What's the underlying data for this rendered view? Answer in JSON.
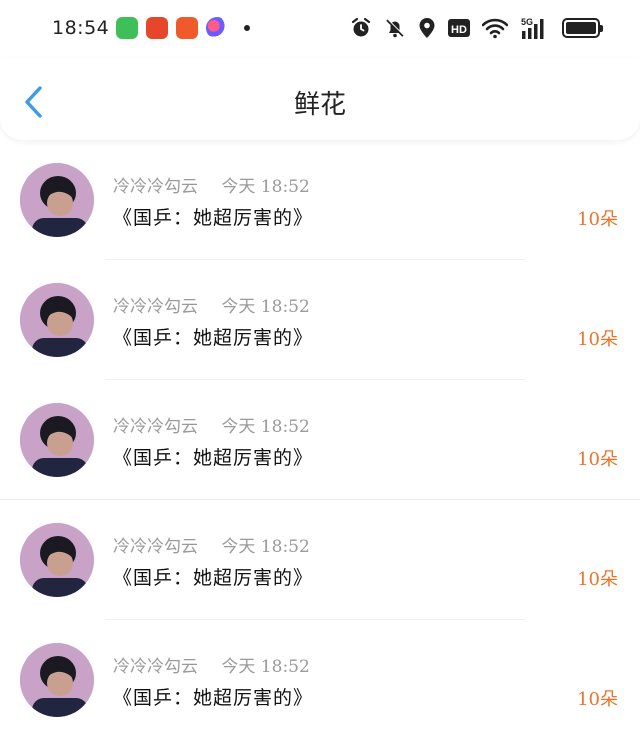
{
  "status_bar": {
    "time": "18:54",
    "app_icons": [
      "messages-icon",
      "video-icon",
      "reader-icon",
      "multicolor-app-icon"
    ],
    "network_label": "5G",
    "hd_label": "HD"
  },
  "header": {
    "title": "鲜花",
    "back_icon": "chevron-left-icon",
    "back_color": "#3b9be8"
  },
  "items": [
    {
      "user": "冷冷冷勾云",
      "time": "今天 18:52",
      "message": "《国乒：她超厉害的》",
      "count": "10朵"
    },
    {
      "user": "冷冷冷勾云",
      "time": "今天 18:52",
      "message": "《国乒：她超厉害的》",
      "count": "10朵"
    },
    {
      "user": "冷冷冷勾云",
      "time": "今天 18:52",
      "message": "《国乒：她超厉害的》",
      "count": "10朵"
    },
    {
      "user": "冷冷冷勾云",
      "time": "今天 18:52",
      "message": "《国乒：她超厉害的》",
      "count": "10朵"
    },
    {
      "user": "冷冷冷勾云",
      "time": "今天 18:52",
      "message": "《国乒：她超厉害的》",
      "count": "10朵"
    }
  ],
  "colors": {
    "accent": "#3b9be8",
    "count": "#e9742a",
    "meta": "#9a9a9a"
  }
}
